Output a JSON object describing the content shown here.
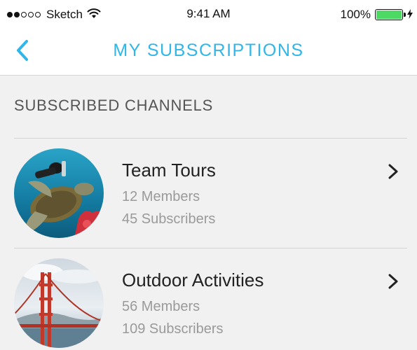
{
  "status_bar": {
    "carrier": "Sketch",
    "signal_filled": 2,
    "signal_total": 5,
    "time": "9:41 AM",
    "battery_percent": "100%",
    "battery_level": 1.0,
    "battery_color": "#4cd964",
    "icons": [
      "wifi-icon",
      "battery-icon",
      "charging-bolt-icon"
    ]
  },
  "nav": {
    "title": "MY SUBSCRIPTIONS",
    "back_icon": "chevron-left-icon",
    "accent_color": "#30b6e8"
  },
  "section": {
    "title": "SUBSCRIBED CHANNELS"
  },
  "channels": [
    {
      "name": "Team Tours",
      "members": "12 Members",
      "subscribers": "45 Subscribers",
      "image": "sea-turtle-diver-photo",
      "chevron_icon": "chevron-right-icon"
    },
    {
      "name": "Outdoor Activities",
      "members": "56 Members",
      "subscribers": "109 Subscribers",
      "image": "golden-gate-bridge-photo",
      "chevron_icon": "chevron-right-icon"
    }
  ]
}
